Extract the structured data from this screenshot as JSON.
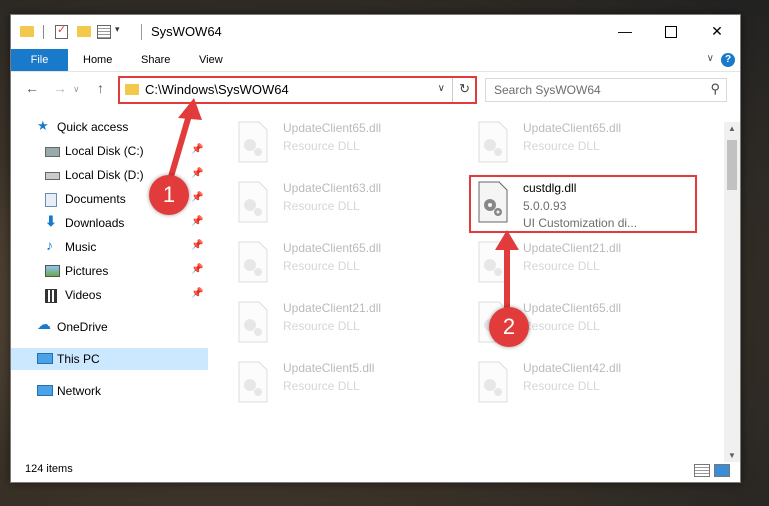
{
  "window": {
    "title": "SysWOW64",
    "tabs": [
      "File",
      "Home",
      "Share",
      "View"
    ],
    "help": "?",
    "controls": {
      "minimize": "—",
      "close": "✕"
    }
  },
  "address": {
    "path": "C:\\Windows\\SysWOW64",
    "search_placeholder": "Search SysWOW64"
  },
  "nav": {
    "back": "←",
    "forward": "→",
    "recent": "∨",
    "up": "↑",
    "items": [
      {
        "label": "Quick access"
      },
      {
        "label": "Local Disk (C:)"
      },
      {
        "label": "Local Disk (D:)"
      },
      {
        "label": "Documents"
      },
      {
        "label": "Downloads"
      },
      {
        "label": "Music"
      },
      {
        "label": "Pictures"
      },
      {
        "label": "Videos"
      },
      {
        "label": "OneDrive"
      },
      {
        "label": "This PC"
      },
      {
        "label": "Network"
      }
    ]
  },
  "files": {
    "left": [
      {
        "name": "UpdateClient65.dll",
        "desc": "Resource DLL"
      },
      {
        "name": "UpdateClient63.dll",
        "desc": "Resource DLL"
      },
      {
        "name": "UpdateClient65.dll",
        "desc": "Resource DLL"
      },
      {
        "name": "UpdateClient21.dll",
        "desc": "Resource DLL"
      },
      {
        "name": "UpdateClient5.dll",
        "desc": "Resource DLL"
      }
    ],
    "right": [
      {
        "name": "UpdateClient65.dll",
        "desc": "Resource DLL"
      },
      {
        "name": "UpdateClient21.dll",
        "desc": "Resource DLL"
      },
      {
        "name": "UpdateClient65.dll",
        "desc": "Resource DLL"
      },
      {
        "name": "UpdateClient42.dll",
        "desc": "Resource DLL"
      }
    ],
    "highlighted": {
      "name": "custdlg.dll",
      "version": "5.0.0.93",
      "desc": "UI Customization di..."
    }
  },
  "status": {
    "count": "124 items"
  },
  "annotations": {
    "step1": "1",
    "step2": "2",
    "color": "#e23b3b"
  }
}
